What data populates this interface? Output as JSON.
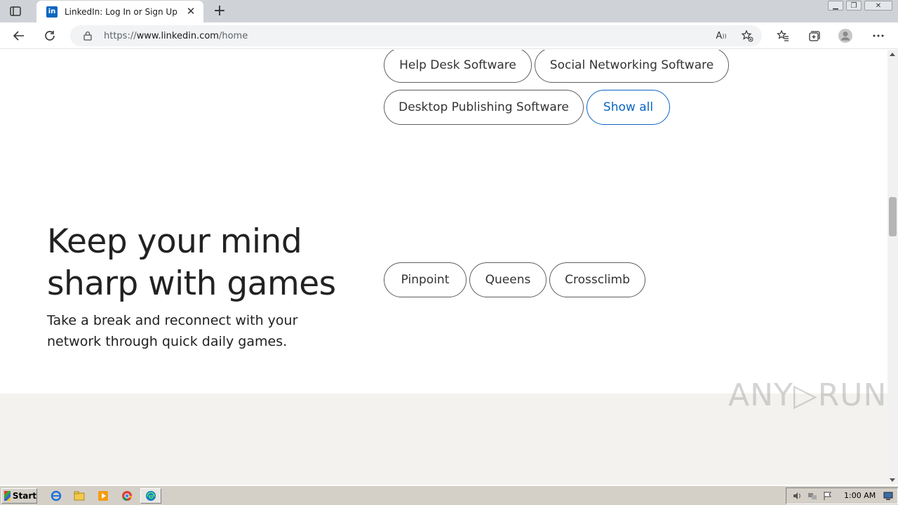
{
  "browser": {
    "tab": {
      "favicon_text": "in",
      "title": "LinkedIn: Log In or Sign Up"
    },
    "url_prefix": "https://",
    "url_host": "www.linkedin.com",
    "url_path": "/home",
    "read_aloud_label": "A"
  },
  "software_pills": [
    "Help Desk Software",
    "Social Networking Software",
    "Desktop Publishing Software"
  ],
  "show_all_label": "Show all",
  "games_section": {
    "headline_line1": "Keep your mind",
    "headline_line2": "sharp with games",
    "subtext": "Take a break and reconnect with your network through quick daily games.",
    "games": [
      "Pinpoint",
      "Queens",
      "Crossclimb"
    ]
  },
  "watermark": "ANY▷RUN",
  "taskbar": {
    "start_label": "Start",
    "clock": "1:00 AM"
  },
  "colors": {
    "link_blue": "#0a66c2",
    "footer_band": "#f3f2ef",
    "taskbar": "#d4d0c8"
  },
  "icons": [
    "tab-actions-icon",
    "linkedin-favicon",
    "close-icon",
    "plus-icon",
    "back-icon",
    "refresh-icon",
    "lock-icon",
    "read-aloud-icon",
    "add-favorite-icon",
    "favorites-icon",
    "collections-icon",
    "profile-icon",
    "more-icon",
    "ie-icon",
    "explorer-icon",
    "media-player-icon",
    "chrome-icon",
    "edge-icon",
    "volume-icon",
    "network-icon",
    "flag-icon",
    "display-icon"
  ]
}
